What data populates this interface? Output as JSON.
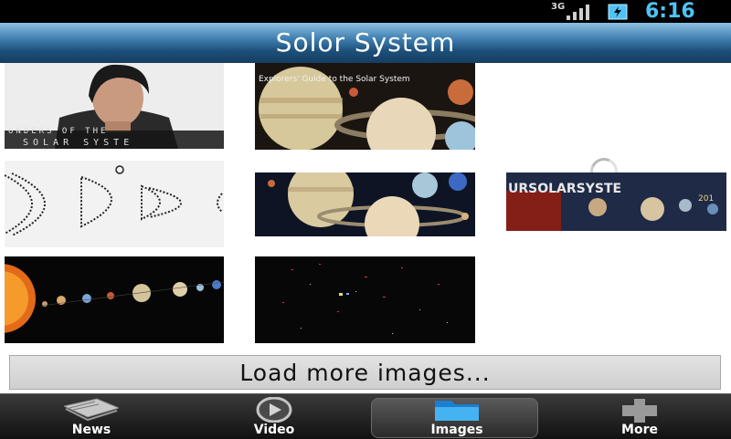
{
  "status_bar": {
    "network": "3G",
    "time": "6:16"
  },
  "title_bar": {
    "title": "Solor System"
  },
  "grid": {
    "tiles": [
      {
        "caption_line1": "ONDERS OF THE",
        "caption_line2": "SOLAR SYSTE"
      },
      {
        "caption": "Explorers' Guide to the Solar System"
      },
      {
        "status": "loading"
      },
      {
        "description": "planet orbit sketch"
      },
      {
        "description": "planets montage"
      },
      {
        "headline": "URSOLARSYSTE",
        "sub": "201"
      },
      {
        "description": "sun and planets in a row"
      },
      {
        "description": "dark star field"
      }
    ]
  },
  "load_more": {
    "label": "Load more images..."
  },
  "tabs": [
    {
      "label": "News",
      "icon": "news-icon",
      "active": false
    },
    {
      "label": "Video",
      "icon": "video-icon",
      "active": false
    },
    {
      "label": "Images",
      "icon": "folder-icon",
      "active": true
    },
    {
      "label": "More",
      "icon": "plus-icon",
      "active": false
    }
  ],
  "colors": {
    "status_time": "#4fc3f7",
    "title_bar": "#1d4f7a",
    "tab_bar": "#111111"
  }
}
